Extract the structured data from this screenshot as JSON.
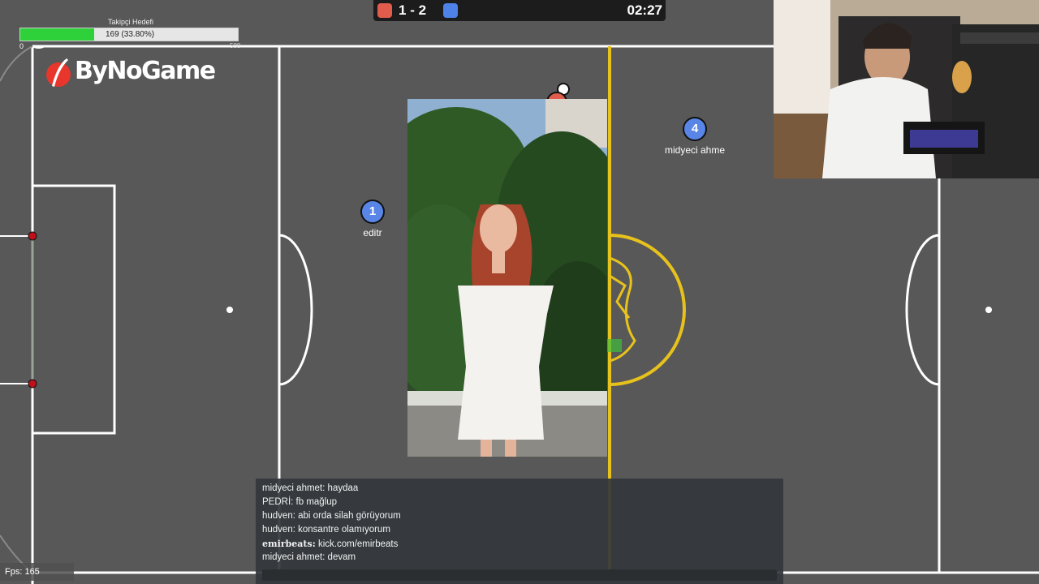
{
  "follower_goal": {
    "title": "Takipçi Hedefi",
    "progress_text": "169 (33.80%)",
    "progress": 0.338,
    "min_label": "0",
    "max_label": "500"
  },
  "logo": {
    "text": "ByNoGame",
    "icon": "feather-pen-icon"
  },
  "scoreboard": {
    "red_score": "1",
    "separator": "-",
    "blue_score": "2",
    "time": "02:27",
    "red_color": "#e25c4e",
    "blue_color": "#4e82e8"
  },
  "players": [
    {
      "number": "1",
      "name": "editr"
    },
    {
      "number": "4",
      "name": "midyeci ahme"
    }
  ],
  "chat": {
    "messages": [
      {
        "user": "midyeci ahmet:",
        "text": "haydaa",
        "bold": false
      },
      {
        "user": "PEDRİ:",
        "text": "fb mağlup",
        "bold": false
      },
      {
        "user": "hudven:",
        "text": "abi orda silah görüyorum",
        "bold": false
      },
      {
        "user": "hudven:",
        "text": "konsantre olamıyorum",
        "bold": false
      },
      {
        "user": "emirbeats:",
        "text": "kick.com/emirbeats",
        "bold": true
      },
      {
        "user": "midyeci ahmet:",
        "text": "devam",
        "bold": false
      }
    ]
  },
  "fps": "Fps: 165",
  "colors": {
    "pitch": "#585858",
    "line": "#ffffff",
    "center_line": "#e8c21c",
    "post": "#c0101a"
  }
}
